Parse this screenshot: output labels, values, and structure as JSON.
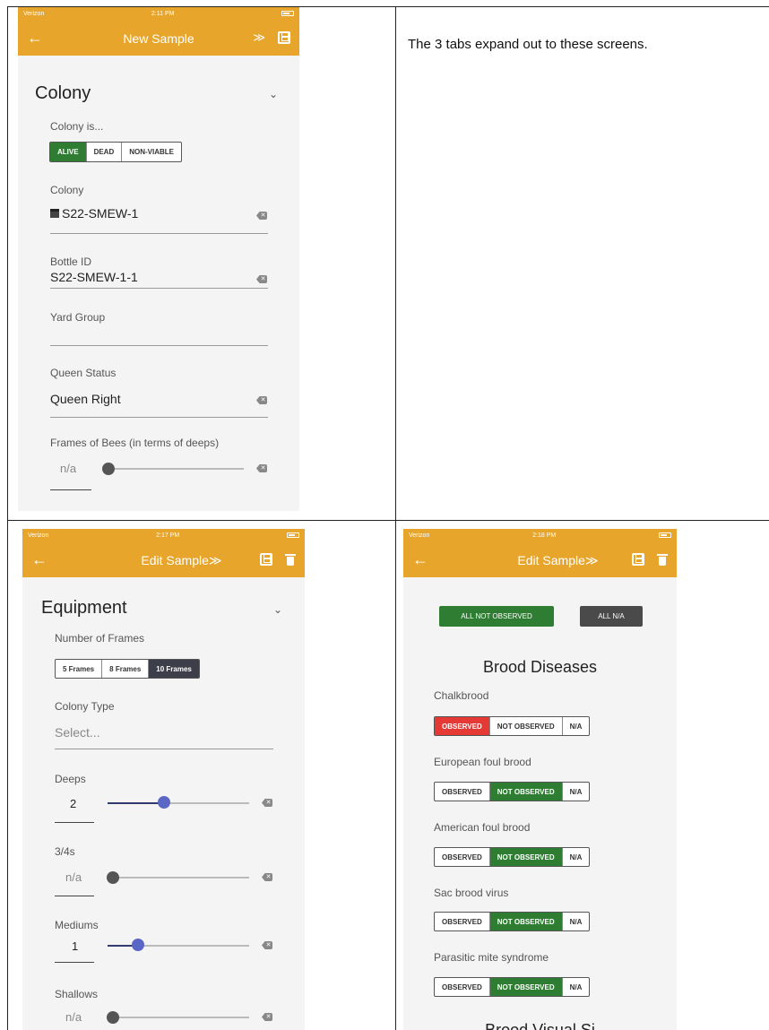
{
  "note": "The 3 tabs expand out to these screens.",
  "colors": {
    "accent": "#e7a52b",
    "green": "#2e7d32",
    "red": "#e53935",
    "dark": "#3c3f4a",
    "slider": "#5b67c4"
  },
  "phone1": {
    "status": {
      "carrier": "Verizon",
      "time": "2:11 PM"
    },
    "appbar": {
      "back": "←",
      "title": "New Sample",
      "expand": "≫"
    },
    "section": "Colony",
    "colony_is_label": "Colony is...",
    "colony_is_options": [
      "ALIVE",
      "DEAD",
      "NON-VIABLE"
    ],
    "colony_label": "Colony",
    "colony_value": "S22-SMEW-1",
    "bottle_label": "Bottle ID",
    "bottle_value": "S22-SMEW-1-1",
    "yard_label": "Yard Group",
    "yard_value": "",
    "queen_label": "Queen Status",
    "queen_value": "Queen Right",
    "frames_label": "Frames of Bees (in terms of deeps)",
    "frames_value": "n/a"
  },
  "phone2": {
    "status": {
      "carrier": "Verizon",
      "time": "2:17 PM"
    },
    "appbar": {
      "back": "←",
      "title": "Edit Sample≫"
    },
    "section": "Equipment",
    "frames_label": "Number of Frames",
    "frames_options": [
      "5 Frames",
      "8 Frames",
      "10 Frames"
    ],
    "colony_type_label": "Colony Type",
    "colony_type_placeholder": "Select...",
    "deeps_label": "Deeps",
    "deeps_value": "2",
    "threequarter_label": "3/4s",
    "threequarter_value": "n/a",
    "mediums_label": "Mediums",
    "mediums_value": "1",
    "shallows_label": "Shallows",
    "shallows_value": "n/a"
  },
  "phone3": {
    "status": {
      "carrier": "Verizon",
      "time": "2:18 PM"
    },
    "appbar": {
      "back": "←",
      "title": "Edit Sample≫"
    },
    "btn_all_not_observed": "ALL NOT OBSERVED",
    "btn_all_na": "ALL N/A",
    "heading": "Brood Diseases",
    "options": [
      "OBSERVED",
      "NOT OBSERVED",
      "N/A"
    ],
    "diseases": [
      {
        "name": "Chalkbrood",
        "selected": "OBSERVED"
      },
      {
        "name": "European foul brood",
        "selected": "NOT OBSERVED"
      },
      {
        "name": "American foul brood",
        "selected": "NOT OBSERVED"
      },
      {
        "name": "Sac brood virus",
        "selected": "NOT OBSERVED"
      },
      {
        "name": "Parasitic mite syndrome",
        "selected": "NOT OBSERVED"
      }
    ],
    "cutoff_heading": "Brood Visual Si"
  }
}
